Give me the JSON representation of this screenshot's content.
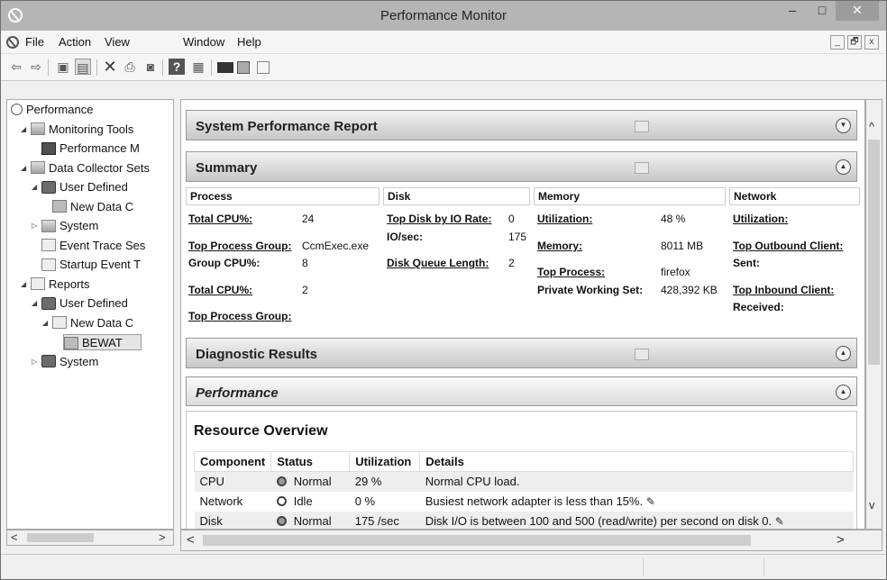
{
  "window": {
    "title": "Performance Monitor",
    "minimize": "–",
    "maximize": "□",
    "close": "✕"
  },
  "menu": {
    "items": [
      "File",
      "Action",
      "View",
      "Window",
      "Help"
    ],
    "mdi": [
      "_",
      "🗗",
      "x"
    ]
  },
  "toolbar": {
    "icons": [
      "back-icon",
      "forward-icon",
      "up-icon",
      "show-hide-tree-icon",
      "delete-icon",
      "print-icon",
      "preview-icon",
      "help-icon",
      "properties-icon",
      "monitor-icon",
      "report-icon",
      "new-window-icon"
    ]
  },
  "tree": [
    {
      "label": "Performance",
      "level": 0,
      "expander": "",
      "icon": "circ"
    },
    {
      "label": "Monitoring Tools",
      "level": 1,
      "expander": "◢",
      "icon": "folder"
    },
    {
      "label": "Performance M",
      "level": 2,
      "expander": "",
      "icon": "mon"
    },
    {
      "label": "Data Collector Sets",
      "level": 1,
      "expander": "◢",
      "icon": "folder"
    },
    {
      "label": "User Defined",
      "level": 2,
      "expander": "◢",
      "icon": "user"
    },
    {
      "label": "New Data C",
      "level": 3,
      "expander": "",
      "icon": "dc"
    },
    {
      "label": "System",
      "level": 2,
      "expander": "▷",
      "icon": "folder"
    },
    {
      "label": "Event Trace Ses",
      "level": 2,
      "expander": "",
      "icon": "rep"
    },
    {
      "label": "Startup Event T",
      "level": 2,
      "expander": "",
      "icon": "rep"
    },
    {
      "label": "Reports",
      "level": 1,
      "expander": "◢",
      "icon": "rep"
    },
    {
      "label": "User Defined",
      "level": 2,
      "expander": "◢",
      "icon": "user"
    },
    {
      "label": "New Data C",
      "level": 3,
      "expander": "◢",
      "icon": "rep"
    },
    {
      "label": "BEWAT",
      "level": 4,
      "expander": "",
      "icon": "dc"
    },
    {
      "label": "System",
      "level": 2,
      "expander": "▷",
      "icon": "user"
    }
  ],
  "report": {
    "title": "System Performance Report",
    "summary_title": "Summary",
    "diagnostic_title": "Diagnostic Results",
    "performance_title": "Performance",
    "resource_title": "Resource Overview"
  },
  "summary": {
    "process": {
      "header": "Process",
      "total_cpu_label": "Total CPU%:",
      "total_cpu": "24",
      "top_group_label": "Top Process Group:",
      "top_group": "CcmExec.exe",
      "group_cpu_label": "Group CPU%:",
      "group_cpu": "8",
      "total_cpu2_label": "Total CPU%:",
      "total_cpu2": "2",
      "top_group2_label": "Top Process Group:"
    },
    "disk": {
      "header": "Disk",
      "top_disk_label": "Top Disk by IO Rate:",
      "top_disk": "0",
      "io_label": "IO/sec:",
      "io": "175",
      "queue_label": "Disk Queue Length:",
      "queue": "2"
    },
    "memory": {
      "header": "Memory",
      "util_label": "Utilization:",
      "util": "48 %",
      "mem_label": "Memory:",
      "mem": "8011 MB",
      "top_process_label": "Top Process:",
      "top_process": "firefox",
      "pws_label": "Private Working Set:",
      "pws": "428,392 KB"
    },
    "network": {
      "header": "Network",
      "util_label": "Utilization:",
      "top_out_label": "Top Outbound Client:",
      "sent_label": "Sent:",
      "top_in_label": "Top Inbound Client:",
      "received_label": "Received:"
    }
  },
  "resource": {
    "headers": [
      "Component",
      "Status",
      "Utilization",
      "Details"
    ],
    "rows": [
      {
        "component": "CPU",
        "status": "Normal",
        "utilization": "29 %",
        "details": "Normal CPU load."
      },
      {
        "component": "Network",
        "status": "Idle",
        "utilization": "0 %",
        "details": "Busiest network adapter is less than 15%."
      },
      {
        "component": "Disk",
        "status": "Normal",
        "utilization": "175 /sec",
        "details": "Disk I/O is between 100 and 500 (read/write) per second on disk 0."
      }
    ]
  }
}
